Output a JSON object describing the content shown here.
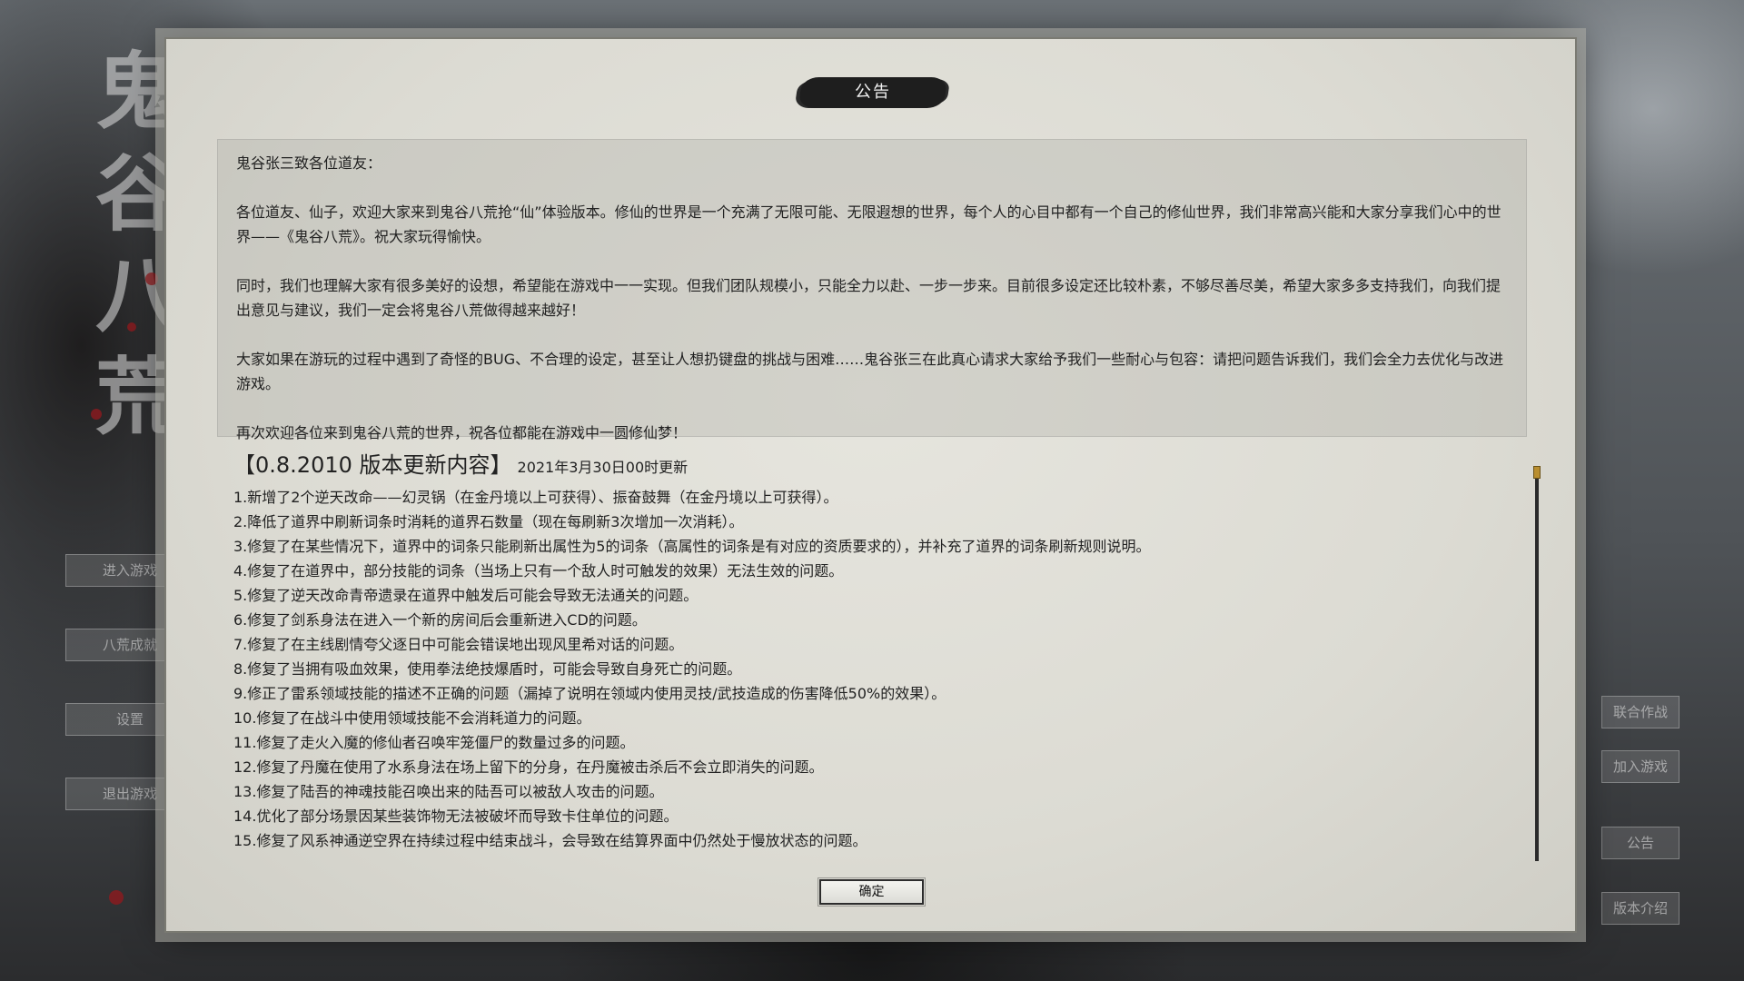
{
  "modal": {
    "title": "公告",
    "notice": {
      "greeting": "鬼谷张三致各位道友：",
      "paragraphs": [
        "各位道友、仙子，欢迎大家来到鬼谷八荒抢“仙”体验版本。修仙的世界是一个充满了无限可能、无限遐想的世界，每个人的心目中都有一个自己的修仙世界，我们非常高兴能和大家分享我们心中的世界——《鬼谷八荒》。祝大家玩得愉快。",
        "同时，我们也理解大家有很多美好的设想，希望能在游戏中一一实现。但我们团队规模小，只能全力以赴、一步一步来。目前很多设定还比较朴素，不够尽善尽美，希望大家多多支持我们，向我们提出意见与建议，我们一定会将鬼谷八荒做得越来越好！",
        "大家如果在游玩的过程中遇到了奇怪的BUG、不合理的设定，甚至让人想扔键盘的挑战与困难……鬼谷张三在此真心请求大家给予我们一些耐心与包容：请把问题告诉我们，我们会全力去优化与改进游戏。",
        "再次欢迎各位来到鬼谷八荒的世界，祝各位都能在游戏中一圆修仙梦！"
      ]
    },
    "update": {
      "heading": "【0.8.2010 版本更新内容】",
      "date": "2021年3月30日00时更新",
      "items": [
        "1.新增了2个逆天改命——幻灵锅（在金丹境以上可获得）、振奋鼓舞（在金丹境以上可获得）。",
        "2.降低了道界中刷新词条时消耗的道界石数量（现在每刷新3次增加一次消耗）。",
        "3.修复了在某些情况下，道界中的词条只能刷新出属性为5的词条（高属性的词条是有对应的资质要求的），并补充了道界的词条刷新规则说明。",
        "4.修复了在道界中，部分技能的词条（当场上只有一个敌人时可触发的效果）无法生效的问题。",
        "5.修复了逆天改命青帝遗录在道界中触发后可能会导致无法通关的问题。",
        "6.修复了剑系身法在进入一个新的房间后会重新进入CD的问题。",
        "7.修复了在主线剧情夸父逐日中可能会错误地出现风里希对话的问题。",
        "8.修复了当拥有吸血效果，使用拳法绝技爆盾时，可能会导致自身死亡的问题。",
        "9.修正了雷系领域技能的描述不正确的问题（漏掉了说明在领域内使用灵技/武技造成的伤害降低50%的效果）。",
        "10.修复了在战斗中使用领域技能不会消耗道力的问题。",
        "11.修复了走火入魔的修仙者召唤牢笼僵尸的数量过多的问题。",
        "12.修复了丹魔在使用了水系身法在场上留下的分身，在丹魔被击杀后不会立即消失的问题。",
        "13.修复了陆吾的神魂技能召唤出来的陆吾可以被敌人攻击的问题。",
        "14.优化了部分场景因某些装饰物无法被破坏而导致卡住单位的问题。",
        "15.修复了风系神通逆空界在持续过程中结束战斗，会导致在结算界面中仍然处于慢放状态的问题。"
      ]
    },
    "confirm_label": "确定",
    "scroll_position": 0
  },
  "background": {
    "calligraphy": "鬼谷八荒",
    "left_menu": [
      "进入游戏",
      "八荒成就",
      "设置",
      "退出游戏"
    ],
    "right_menu": [
      "联合作战",
      "加入游戏",
      "公告",
      "版本介绍"
    ]
  }
}
